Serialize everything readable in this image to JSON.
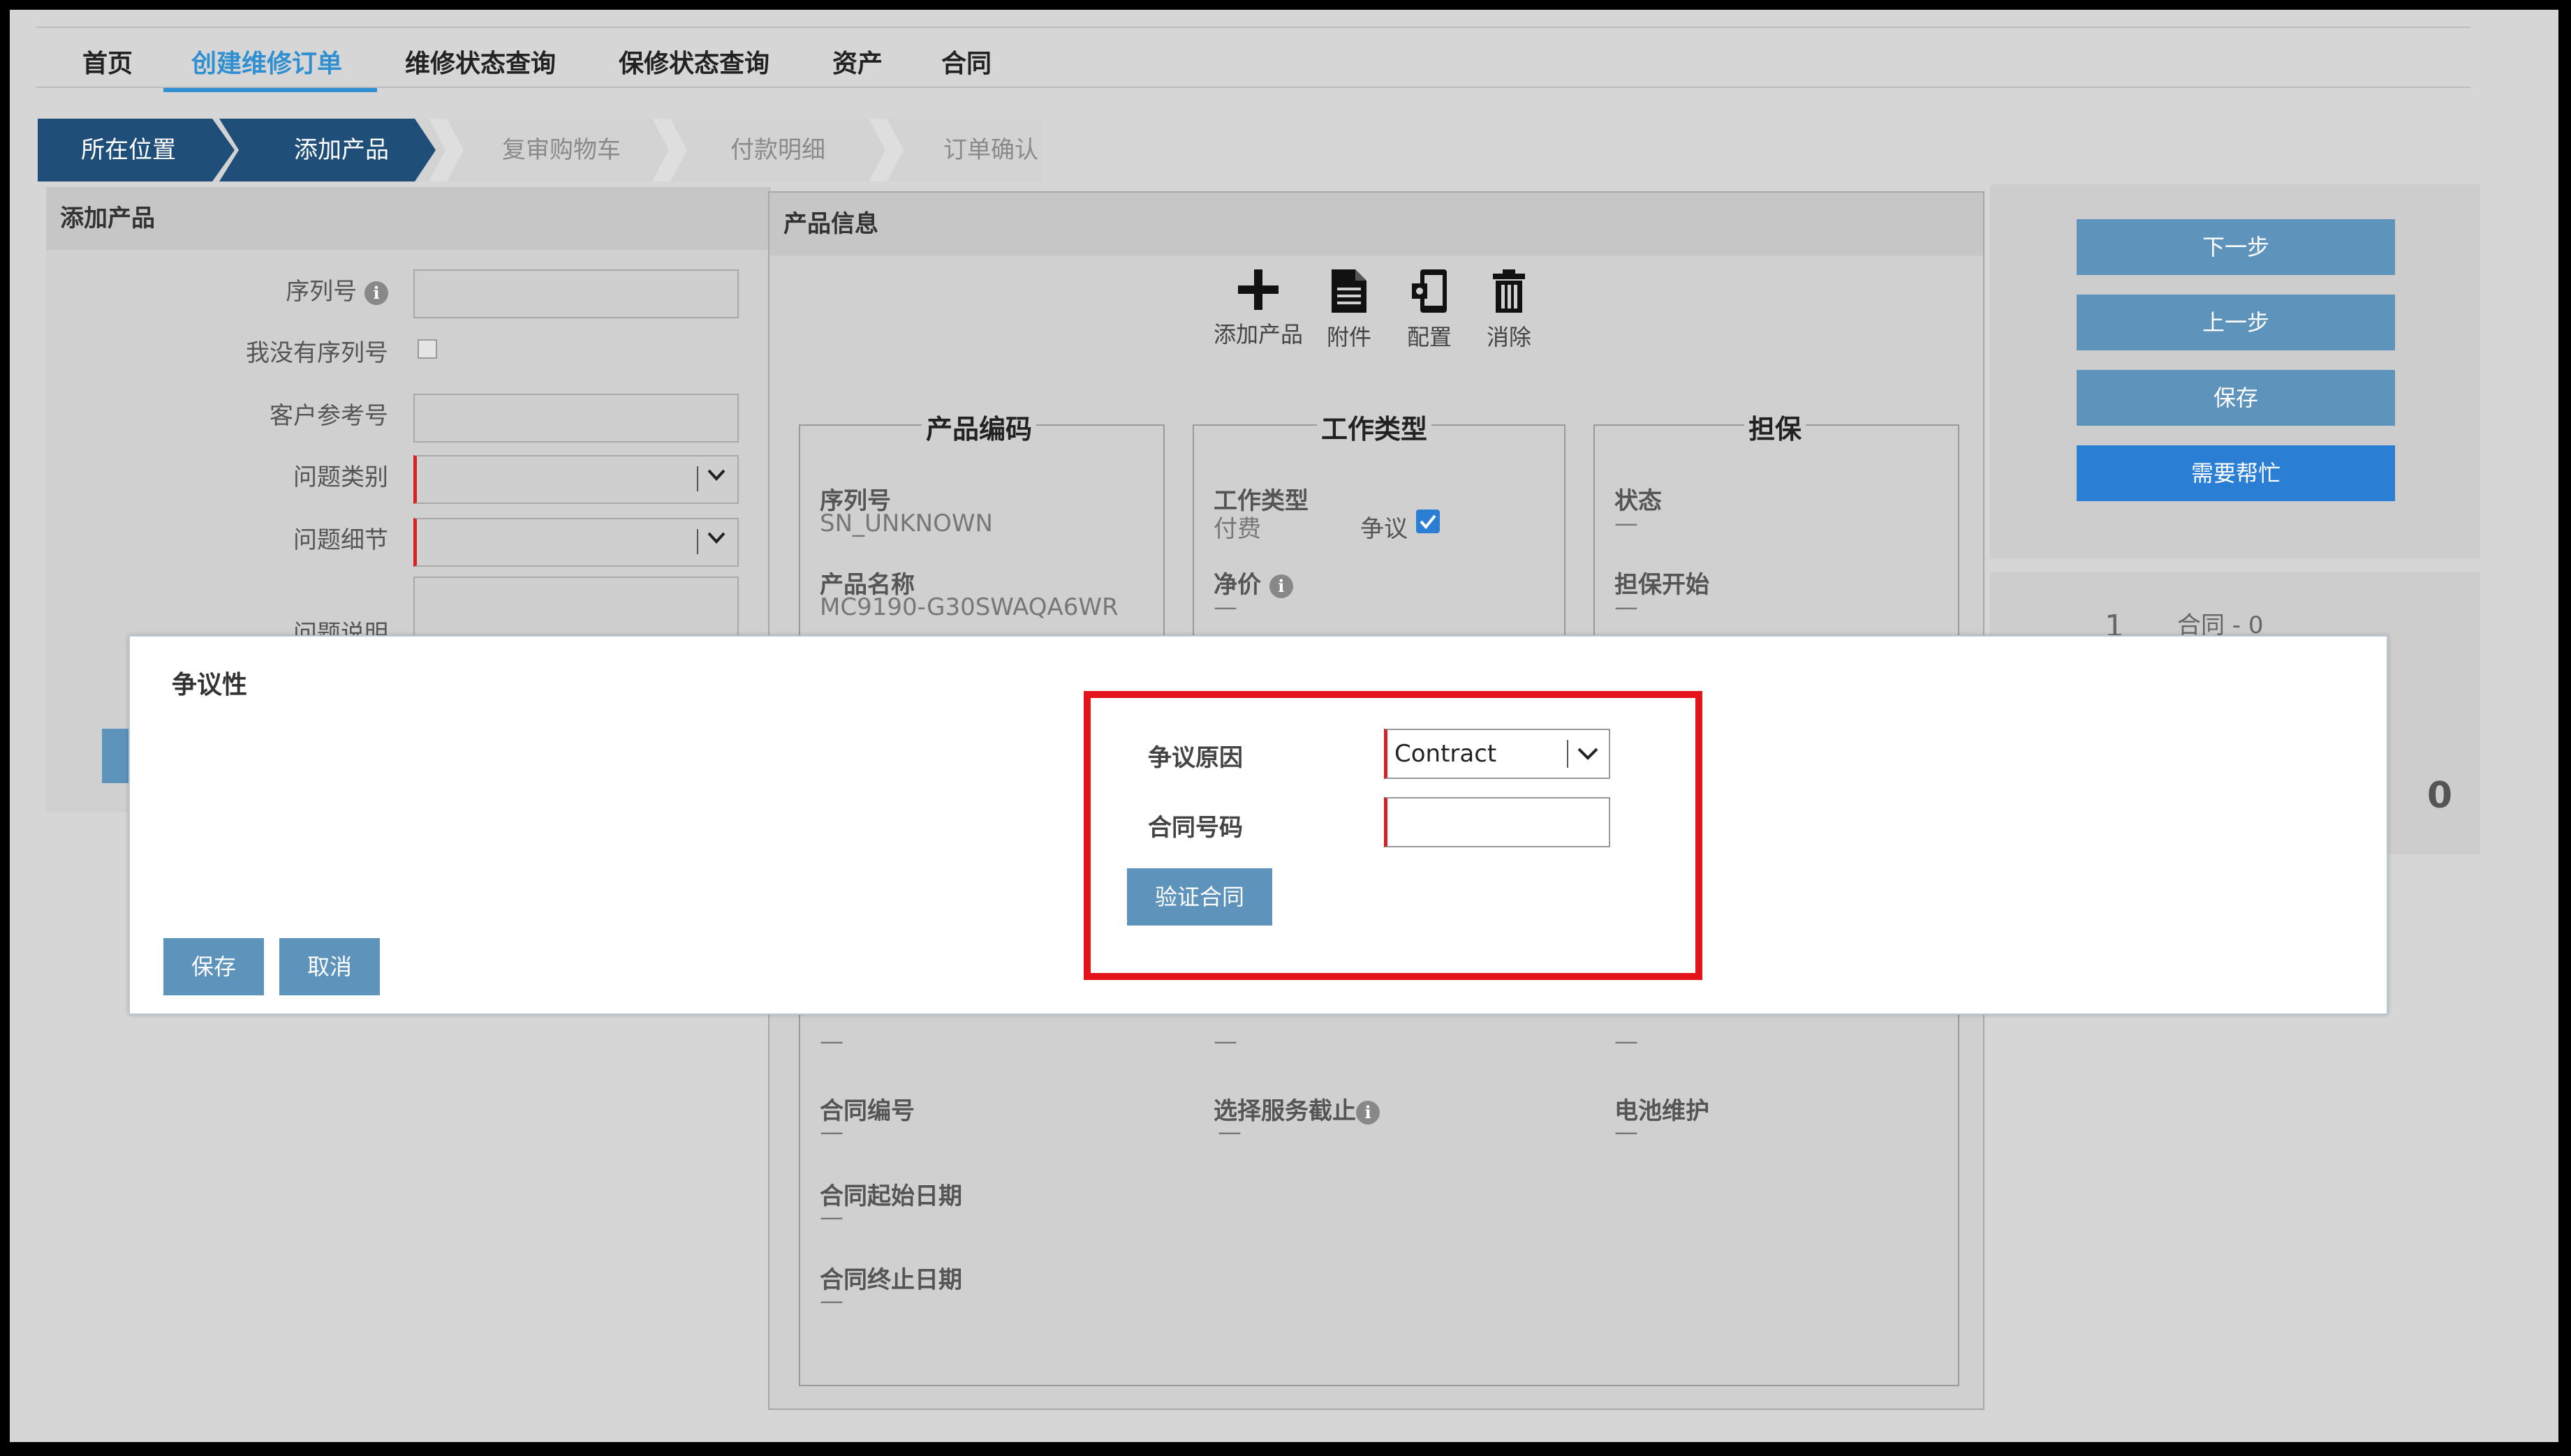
{
  "nav": {
    "items": [
      "首页",
      "创建维修订单",
      "维修状态查询",
      "保修状态查询",
      "资产",
      "合同"
    ],
    "active_index": 1
  },
  "breadcrumb": {
    "steps": [
      "所在位置",
      "添加产品",
      "复审购物车",
      "付款明细",
      "订单确认"
    ],
    "completed_count": 2
  },
  "add_product_panel": {
    "title": "添加产品",
    "serial_label": "序列号",
    "no_serial_label": "我没有序列号",
    "customer_ref_label": "客户参考号",
    "problem_category_label": "问题类别",
    "problem_detail_label": "问题细节",
    "problem_desc_label": "问题说明"
  },
  "product_info_panel": {
    "title": "产品信息",
    "toolbar": {
      "add_product": "添加产品",
      "attachment": "附件",
      "config": "配置",
      "delete": "消除"
    },
    "product_code": {
      "legend": "产品编码",
      "serial_label": "序列号",
      "serial_value": "SN_UNKNOWN",
      "name_label": "产品名称",
      "name_value": "MC9190-G30SWAQA6WR"
    },
    "work_type": {
      "legend": "工作类型",
      "label": "工作类型",
      "value": "付费",
      "dispute_label": "争议",
      "dispute_checked": true,
      "net_price_label": "净价",
      "net_price_value": "—"
    },
    "warranty": {
      "legend": "担保",
      "status_label": "状态",
      "status_value": "—",
      "start_label": "担保开始",
      "start_value": "—"
    },
    "lower": {
      "col1_top_value": "—",
      "col2_top_value": "—",
      "col3_top_value": "—",
      "contract_no_label": "合同编号",
      "contract_no_value": "—",
      "service_cutoff_label": "选择服务截止",
      "service_cutoff_value": "—",
      "battery_label": "电池维护",
      "battery_value": "—",
      "contract_start_label": "合同起始日期",
      "contract_start_value": "—",
      "contract_end_label": "合同终止日期",
      "contract_end_value": "—"
    }
  },
  "right_panel": {
    "next": "下一步",
    "prev": "上一步",
    "save": "保存",
    "help": "需要帮忙",
    "contract_count_label": "合同 - 0",
    "big_digit": "1",
    "big_right": "0"
  },
  "modal": {
    "title": "争议性",
    "dispute_reason_label": "争议原因",
    "dispute_reason_value": "Contract",
    "contract_number_label": "合同号码",
    "contract_number_value": "",
    "verify_button": "验证合同",
    "save_button": "保存",
    "cancel_button": "取消"
  },
  "colors": {
    "accent_blue": "#2f8fd1",
    "breadcrumb_dark": "#1f4e79",
    "button_blue": "#5e93bb",
    "help_blue": "#2a7fd4",
    "required_red": "#d42222",
    "highlight_red": "#e3151a"
  }
}
